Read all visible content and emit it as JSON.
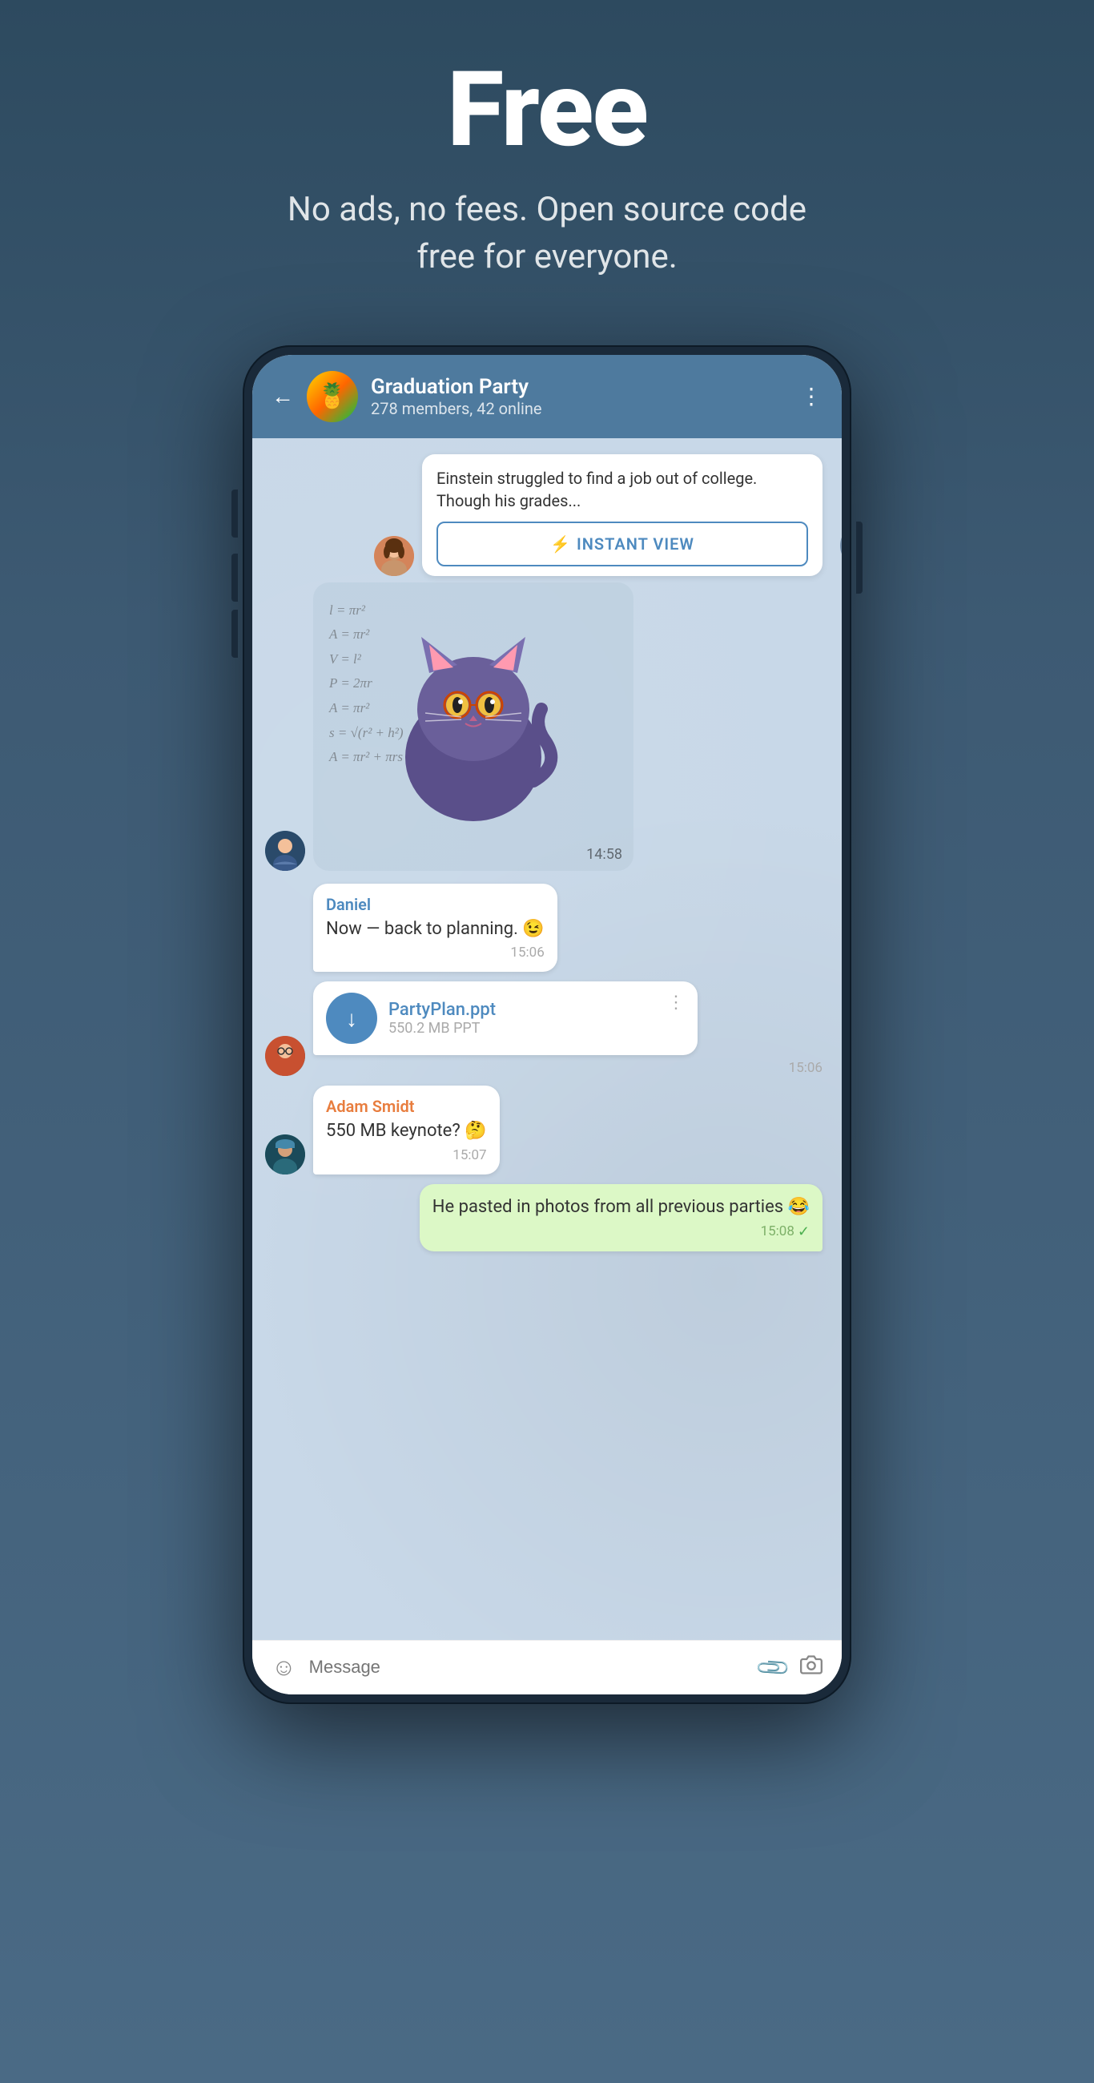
{
  "page": {
    "hero": {
      "title": "Free",
      "subtitle": "No ads, no fees. Open source code free for everyone."
    },
    "chat": {
      "header": {
        "group_name": "Graduation Party",
        "members_info": "278 members, 42 online",
        "back_label": "←",
        "menu_label": "⋮",
        "avatar_emoji": "🍍"
      },
      "messages": [
        {
          "type": "article",
          "text": "Einstein struggled to find a job out of college. Though his grades...",
          "instant_view_label": "INSTANT VIEW",
          "time": "",
          "sender": "girl"
        },
        {
          "type": "sticker",
          "time": "14:58",
          "sender": "guy1"
        },
        {
          "type": "bubble_white",
          "sender_name": "Daniel",
          "text": "Now — back to planning. 😉",
          "time": "15:06",
          "sender": "none"
        },
        {
          "type": "file",
          "file_name": "PartyPlan.ppt",
          "file_size": "550.2 MB PPT",
          "time": "15:06",
          "sender": "guy2"
        },
        {
          "type": "bubble_white",
          "sender_name": "Adam Smidt",
          "text": "550 MB keynote? 🤔",
          "time": "15:07",
          "sender": "guy3"
        },
        {
          "type": "bubble_green",
          "text": "He pasted in photos from all previous parties 😂",
          "time": "15:08",
          "sender": "self"
        }
      ],
      "input_placeholder": "Message"
    }
  }
}
